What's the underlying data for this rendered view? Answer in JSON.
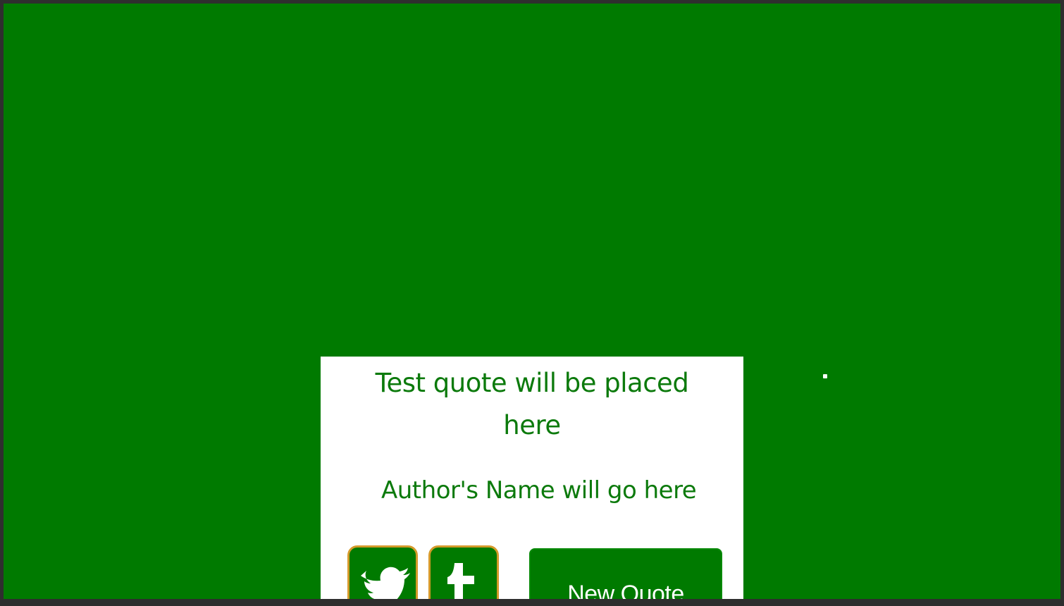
{
  "quote": {
    "text": "Test quote will be placed here",
    "author": "Author's Name will go here"
  },
  "buttons": {
    "new_quote_label": "New Quote",
    "twitter_icon": "twitter-icon",
    "tumblr_icon": "tumblr-icon"
  },
  "colors": {
    "background": "#007a00",
    "card": "#ffffff",
    "text": "#0c7a0c",
    "icon_border": "#d49a2a"
  }
}
